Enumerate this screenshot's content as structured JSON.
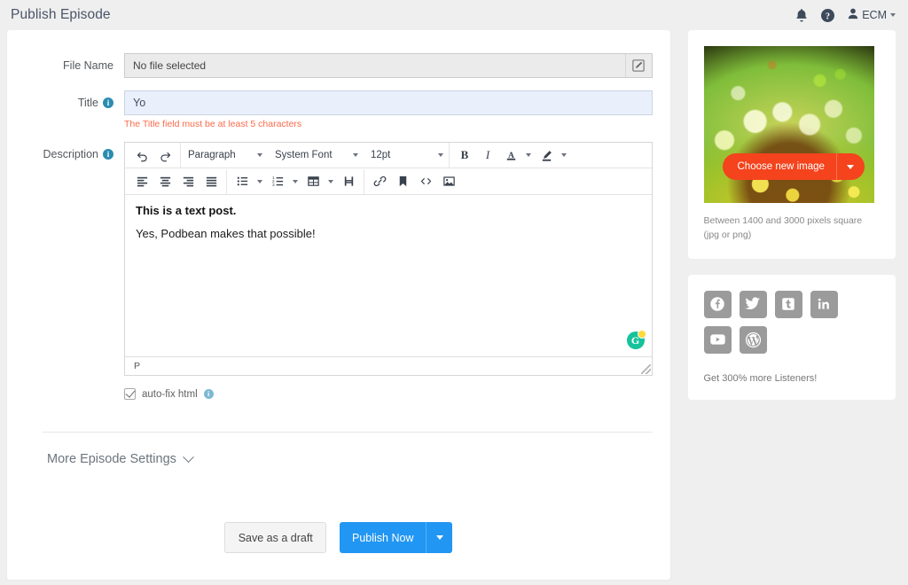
{
  "header": {
    "title": "Publish Episode",
    "bell_icon": "bell-icon",
    "help_icon": "help-circle-icon",
    "user_label": "ECM",
    "user_icon": "person-icon",
    "user_caret": "chevron-down-icon"
  },
  "form": {
    "file_name": {
      "label": "File Name",
      "value": "No file selected",
      "edit_icon": "edit-pencil-icon"
    },
    "title": {
      "label": "Title",
      "value": "Yo",
      "placeholder": "",
      "info_char": "i",
      "error": "The Title field must be at least 5 characters"
    },
    "description": {
      "label": "Description",
      "info_char": "i",
      "toolbar_row1": {
        "undo_icon": "undo-icon",
        "redo_icon": "redo-icon",
        "block_format": "Paragraph",
        "font_family": "System Font",
        "font_size": "12pt",
        "bold_label": "B",
        "italic_label": "I",
        "text_color_label": "A",
        "highlight_icon": "highlight-pen-icon"
      },
      "toolbar_row2": {
        "align_left_icon": "align-left-icon",
        "align_center_icon": "align-center-icon",
        "align_right_icon": "align-right-icon",
        "align_justify_icon": "align-justify-icon",
        "bullet_list_icon": "bullet-list-icon",
        "numbered_list_icon": "numbered-list-icon",
        "table_icon": "table-icon",
        "page_break_icon": "page-break-icon",
        "link_icon": "link-icon",
        "anchor_icon": "bookmark-anchor-icon",
        "source_code_icon": "source-code-icon",
        "insert_image_icon": "insert-image-icon"
      },
      "content_heading": "This is a text post.",
      "content_paragraph": "Yes, Podbean makes that possible!",
      "grammarly_icon": "grammarly-icon",
      "grammarly_letter": "G",
      "status_path": "P",
      "resize_handle": "resize-handle"
    },
    "auto_fix": {
      "label": "auto-fix html",
      "checked": true,
      "info_char": "i"
    }
  },
  "more_settings": {
    "label": "More Episode Settings",
    "caret_icon": "chevron-down-icon"
  },
  "actions": {
    "draft_label": "Save as a draft",
    "publish_label": "Publish Now",
    "publish_caret_icon": "chevron-down-icon"
  },
  "cover": {
    "choose_label": "Choose new image",
    "choose_caret_icon": "chevron-down-icon",
    "note": "Between 1400 and 3000 pixels square (jpg or png)",
    "image_alt": "podcast-cover-art"
  },
  "social": {
    "items": [
      {
        "name": "facebook-icon",
        "letter": "f"
      },
      {
        "name": "twitter-icon",
        "letter": "t"
      },
      {
        "name": "tumblr-icon",
        "letter": "t"
      },
      {
        "name": "linkedin-icon",
        "letter": "in"
      },
      {
        "name": "youtube-icon",
        "letter": "▶"
      },
      {
        "name": "wordpress-icon",
        "letter": "W"
      }
    ],
    "note": "Get 300% more Listeners!"
  },
  "colors": {
    "accent_blue": "#2196f3",
    "accent_orange": "#f4431d",
    "error_red": "#fc6a4b",
    "info_blue": "#2b8cb0",
    "page_bg": "#efefef"
  }
}
